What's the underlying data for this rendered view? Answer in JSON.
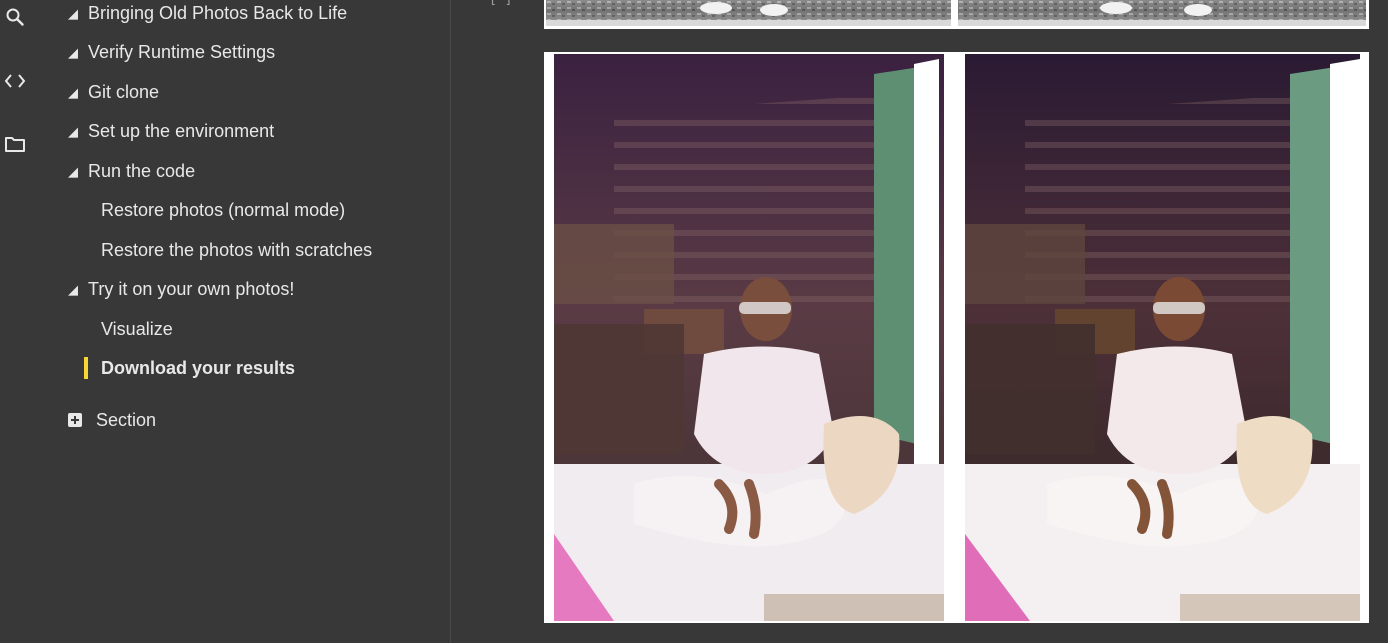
{
  "sidebar_icons": [
    "search-icon",
    "code-icon",
    "folder-icon"
  ],
  "toc": {
    "items": [
      {
        "label": "Bringing Old Photos Back to Life",
        "level": 1
      },
      {
        "label": "Verify Runtime Settings",
        "level": 1
      },
      {
        "label": "Git clone",
        "level": 1
      },
      {
        "label": "Set up the environment",
        "level": 1
      },
      {
        "label": "Run the code",
        "level": 1
      },
      {
        "label": "Restore photos (normal mode)",
        "level": 2
      },
      {
        "label": "Restore the photos with scratches",
        "level": 2
      },
      {
        "label": "Try it on your own photos!",
        "level": 1
      },
      {
        "label": "Visualize",
        "level": 2
      },
      {
        "label": "Download your results",
        "level": 2,
        "active": true
      }
    ],
    "add_section_label": "Section"
  },
  "colors": {
    "background": "#383838",
    "text": "#e8e8e8",
    "active_marker": "#f9d536"
  },
  "output": {
    "execution_count": "[ ]",
    "images": [
      "bw-photo-comparison-top",
      "restored-photo-comparison"
    ]
  }
}
